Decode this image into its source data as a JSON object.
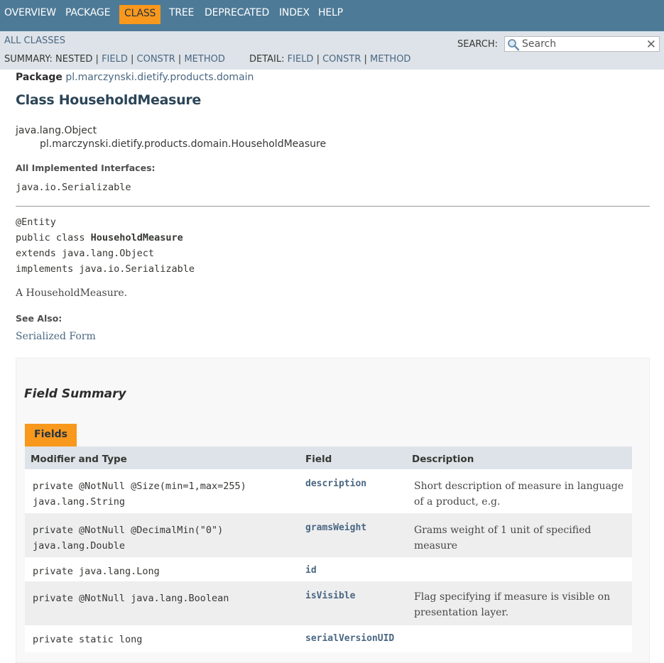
{
  "topnav": {
    "items": [
      "OVERVIEW",
      "PACKAGE",
      "CLASS",
      "TREE",
      "DEPRECATED",
      "INDEX",
      "HELP"
    ],
    "active": "CLASS"
  },
  "subnav": {
    "all_classes": "ALL CLASSES",
    "summary_label": "SUMMARY:",
    "summary_nested": "NESTED",
    "summary_field": "FIELD",
    "summary_constr": "CONSTR",
    "summary_method": "METHOD",
    "detail_label": "DETAIL:",
    "detail_field": "FIELD",
    "detail_constr": "CONSTR",
    "detail_method": "METHOD",
    "sep": "|"
  },
  "search": {
    "label": "SEARCH:",
    "placeholder": "Search",
    "clear": "✕"
  },
  "header": {
    "package_label": "Package",
    "package_name": "pl.marczynski.dietify.products.domain",
    "class_title": "Class HouseholdMeasure",
    "inheritance_root": "java.lang.Object",
    "inheritance_child": "pl.marczynski.dietify.products.domain.HouseholdMeasure",
    "interfaces_label": "All Implemented Interfaces:",
    "interfaces_value": "java.io.Serializable"
  },
  "signature": {
    "annotation": "@Entity",
    "decl_prefix": "public class ",
    "class_name": "HouseholdMeasure",
    "extends_line": "extends java.lang.Object",
    "implements_line": "implements java.io.Serializable"
  },
  "description": "A HouseholdMeasure.",
  "see_also": {
    "label": "See Also:",
    "link": "Serialized Form"
  },
  "field_summary": {
    "title": "Field Summary",
    "tab": "Fields",
    "columns": [
      "Modifier and Type",
      "Field",
      "Description"
    ],
    "rows": [
      {
        "type1": "private @NotNull @Size(min=1,max=255)",
        "type2": "java.lang.String",
        "field": "description",
        "desc1": "Short description of measure in language",
        "desc2": "of a product, e.g."
      },
      {
        "type1": "private @NotNull @DecimalMin(\"0\")",
        "type2": "java.lang.Double",
        "field": "gramsWeight",
        "desc1": "Grams weight of 1 unit of specified",
        "desc2": "measure"
      },
      {
        "type1": "private java.lang.Long",
        "type2": "",
        "field": "id",
        "desc1": "",
        "desc2": ""
      },
      {
        "type1": "private @NotNull java.lang.Boolean",
        "type2": "",
        "field": "isVisible",
        "desc1": "Flag specifying if measure is visible on",
        "desc2": "presentation layer."
      },
      {
        "type1": "private static long",
        "type2": "",
        "field": "serialVersionUID",
        "desc1": "",
        "desc2": ""
      }
    ]
  }
}
